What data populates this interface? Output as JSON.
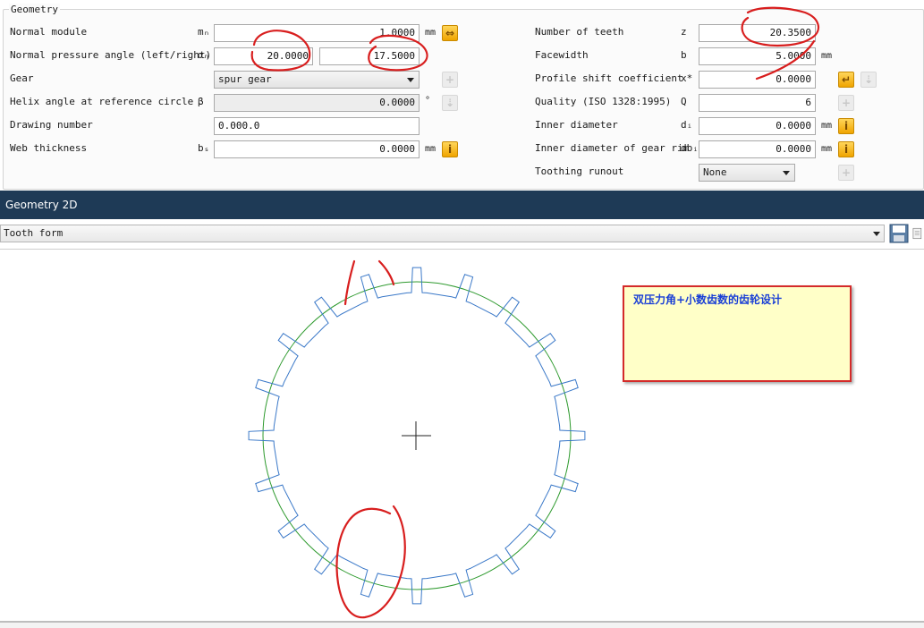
{
  "geometry": {
    "group_title": "Geometry",
    "normal_module": {
      "label": "Normal module",
      "symbol": "mₙ",
      "value": "1.0000",
      "unit": "mm"
    },
    "pressure_angle": {
      "label": "Normal pressure angle (left/right)",
      "symbol": "αₙ",
      "left_value": "20.0000",
      "right_value": "17.5000"
    },
    "gear": {
      "label": "Gear",
      "value": "spur gear"
    },
    "helix_angle": {
      "label": "Helix angle at reference circle",
      "symbol": "β",
      "value": "0.0000",
      "unit": "°"
    },
    "drawing_number": {
      "label": "Drawing number",
      "value": "0.000.0"
    },
    "web_thickness": {
      "label": "Web thickness",
      "symbol": "bₛ",
      "value": "0.0000",
      "unit": "mm"
    },
    "number_of_teeth": {
      "label": "Number of teeth",
      "symbol": "z",
      "value": "20.3500"
    },
    "facewidth": {
      "label": "Facewidth",
      "symbol": "b",
      "value": "5.0000",
      "unit": "mm"
    },
    "profile_shift": {
      "label": "Profile shift coefficient",
      "symbol": "x*",
      "value": "0.0000"
    },
    "quality": {
      "label": "Quality (ISO 1328:1995)",
      "symbol": "Q",
      "value": "6"
    },
    "inner_diameter": {
      "label": "Inner diameter",
      "symbol": "dᵢ",
      "value": "0.0000",
      "unit": "mm"
    },
    "inner_diameter_rim": {
      "label": "Inner diameter of gear rim",
      "symbol": "dbᵢ",
      "value": "0.0000",
      "unit": "mm"
    },
    "toothing_runout": {
      "label": "Toothing runout",
      "value": "None"
    }
  },
  "geometry2d": {
    "title": "Geometry 2D",
    "view_select": "Tooth form",
    "note_text": "双压力角+小数齿数的齿轮设计"
  },
  "colors": {
    "header_bg": "#1e3a56",
    "tooth_outline": "#3a78c8",
    "pitch_circle": "#2e9a2e",
    "annotation_red": "#d81e1e",
    "note_bg": "#ffffc8",
    "note_text": "#1a3fd6"
  },
  "icons": {
    "convert": "double-arrow-icon",
    "info": "info-icon",
    "back": "return-arrow-icon",
    "save": "save-icon",
    "disabled": "plus-icon"
  }
}
